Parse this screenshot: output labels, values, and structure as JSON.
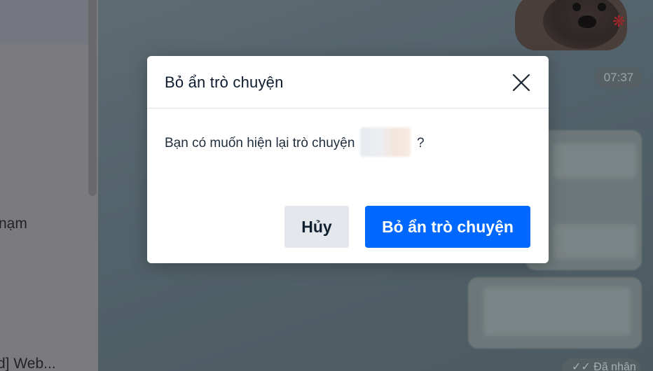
{
  "sidebar": {
    "items": [
      {
        "label": "nạm"
      },
      {
        "label": "d] Web..."
      }
    ]
  },
  "chat": {
    "time": "07:37",
    "received_status": "Đã nhận",
    "sticker_icon": "angry-dog-sticker",
    "anger_icon": "anger-symbol"
  },
  "modal": {
    "title": "Bỏ ẩn trò chuyện",
    "close_icon": "close-icon",
    "message_prefix": "Bạn có muốn hiện lại trò chuyện",
    "message_suffix": "?",
    "cancel_label": "Hủy",
    "confirm_label": "Bỏ ẩn trò chuyện"
  },
  "colors": {
    "accent": "#0068ff",
    "cancel_bg": "#e4e7ec",
    "title_text": "#0d1b2e"
  }
}
